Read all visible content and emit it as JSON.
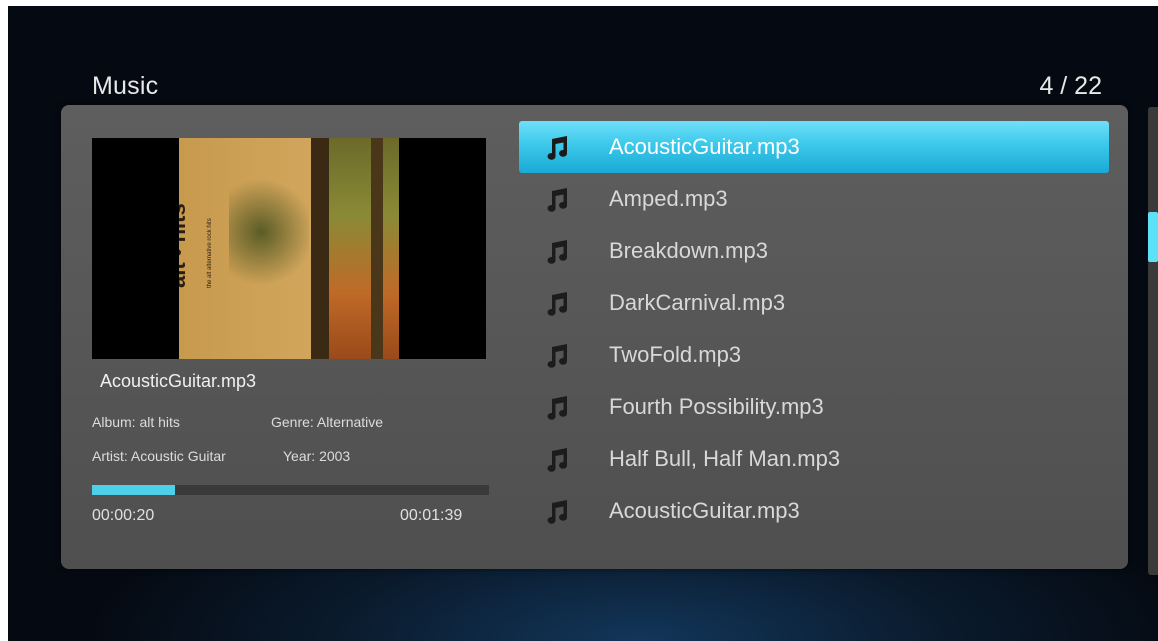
{
  "header": {
    "title": "Music",
    "page_counter": "4 / 22"
  },
  "now_playing": {
    "album_art_text": "alt • hits",
    "album_art_subtext": "the alt alternative rock hits",
    "track_name": "AcousticGuitar.mp3",
    "album": "Album: alt hits",
    "genre": "Genre: Alternative",
    "artist": "Artist: Acoustic Guitar",
    "year": "Year: 2003",
    "elapsed": "00:00:20",
    "total": "00:01:39",
    "progress_fraction": 0.21
  },
  "playlist": {
    "selected_index": 0,
    "item_icon": "music-note-icon",
    "items": [
      {
        "label": "AcousticGuitar.mp3"
      },
      {
        "label": "Amped.mp3"
      },
      {
        "label": "Breakdown.mp3"
      },
      {
        "label": "DarkCarnival.mp3"
      },
      {
        "label": "TwoFold.mp3"
      },
      {
        "label": "Fourth Possibility.mp3"
      },
      {
        "label": "Half Bull, Half Man.mp3"
      },
      {
        "label": "AcousticGuitar.mp3"
      }
    ]
  },
  "scrollbar": {
    "position_fraction": 0.25
  },
  "colors": {
    "accent": "#3cc8ea",
    "panel": "#575757",
    "background": "#07101c"
  }
}
